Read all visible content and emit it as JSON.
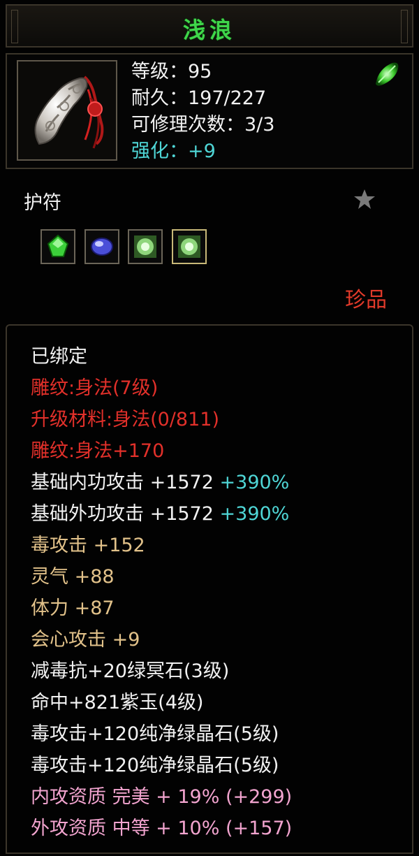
{
  "item": {
    "name": "浅浪",
    "level": "等级：95",
    "durability": "耐久：197/227",
    "repair": "可修理次数：3/3",
    "enhance": "强化：+9",
    "type": "护符",
    "rarity": "珍品"
  },
  "colors": {
    "name": "#3fd64a",
    "red": "#e2302a",
    "gold": "#e2c28a",
    "pink": "#f2a4cf",
    "cyan": "#4fd6d6"
  },
  "sockets": [
    {
      "icon": "green-gem-icon"
    },
    {
      "icon": "purple-gem-icon"
    },
    {
      "icon": "green-crystal-icon"
    },
    {
      "icon": "green-crystal-icon"
    }
  ],
  "attributes": {
    "bound": "已绑定",
    "engrave1": "雕纹:身法(7级)",
    "upgrade": "升级材料:身法(0/811)",
    "engrave2": "雕纹:身法+170",
    "inner_attack": "基础内功攻击 +1572",
    "inner_attack_pct": "+390%",
    "outer_attack": "基础外功攻击 +1572",
    "outer_attack_pct": "+390%",
    "poison_attack": "毒攻击 +152",
    "spirit": "灵气 +88",
    "stamina": "体力 +87",
    "crit": "会心攻击 +9",
    "gem1": "减毒抗+20绿冥石(3级)",
    "gem2": "命中+821紫玉(4级)",
    "gem3": "毒攻击+120纯净绿晶石(5级)",
    "gem4": "毒攻击+120纯净绿晶石(5级)",
    "quality_inner": "内攻资质 完美 + 19% (+299)",
    "quality_outer": "外攻资质 中等 + 10% (+157)"
  }
}
